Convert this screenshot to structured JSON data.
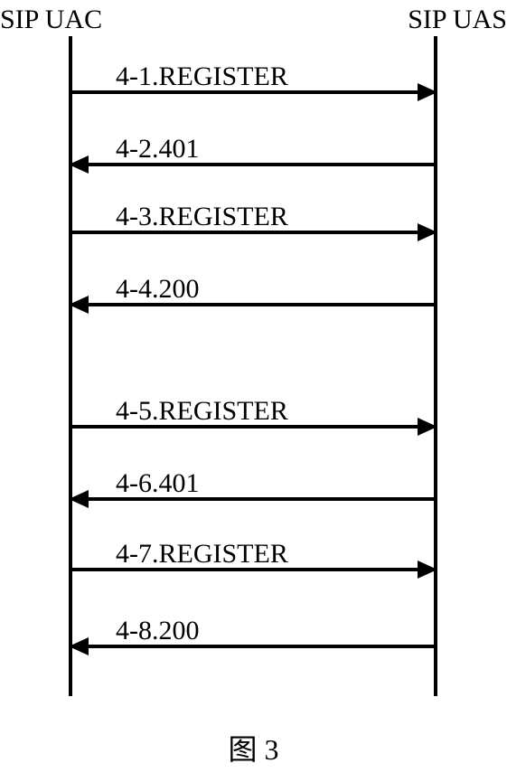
{
  "actors": {
    "left": "SIP UAC",
    "right": "SIP UAS"
  },
  "messages": {
    "m1": "4-1.REGISTER",
    "m2": "4-2.401",
    "m3": "4-3.REGISTER",
    "m4": "4-4.200",
    "m5": "4-5.REGISTER",
    "m6": "4-6.401",
    "m7": "4-7.REGISTER",
    "m8": "4-8.200"
  },
  "caption": "图 3",
  "chart_data": {
    "type": "sequence-diagram",
    "participants": [
      "SIP UAC",
      "SIP UAS"
    ],
    "messages": [
      {
        "step": "4-1",
        "from": "SIP UAC",
        "to": "SIP UAS",
        "label": "REGISTER"
      },
      {
        "step": "4-2",
        "from": "SIP UAS",
        "to": "SIP UAC",
        "label": "401"
      },
      {
        "step": "4-3",
        "from": "SIP UAC",
        "to": "SIP UAS",
        "label": "REGISTER"
      },
      {
        "step": "4-4",
        "from": "SIP UAS",
        "to": "SIP UAC",
        "label": "200"
      },
      {
        "step": "4-5",
        "from": "SIP UAC",
        "to": "SIP UAS",
        "label": "REGISTER"
      },
      {
        "step": "4-6",
        "from": "SIP UAS",
        "to": "SIP UAC",
        "label": "401"
      },
      {
        "step": "4-7",
        "from": "SIP UAC",
        "to": "SIP UAS",
        "label": "REGISTER"
      },
      {
        "step": "4-8",
        "from": "SIP UAS",
        "to": "SIP UAC",
        "label": "200"
      }
    ],
    "caption": "图 3"
  }
}
